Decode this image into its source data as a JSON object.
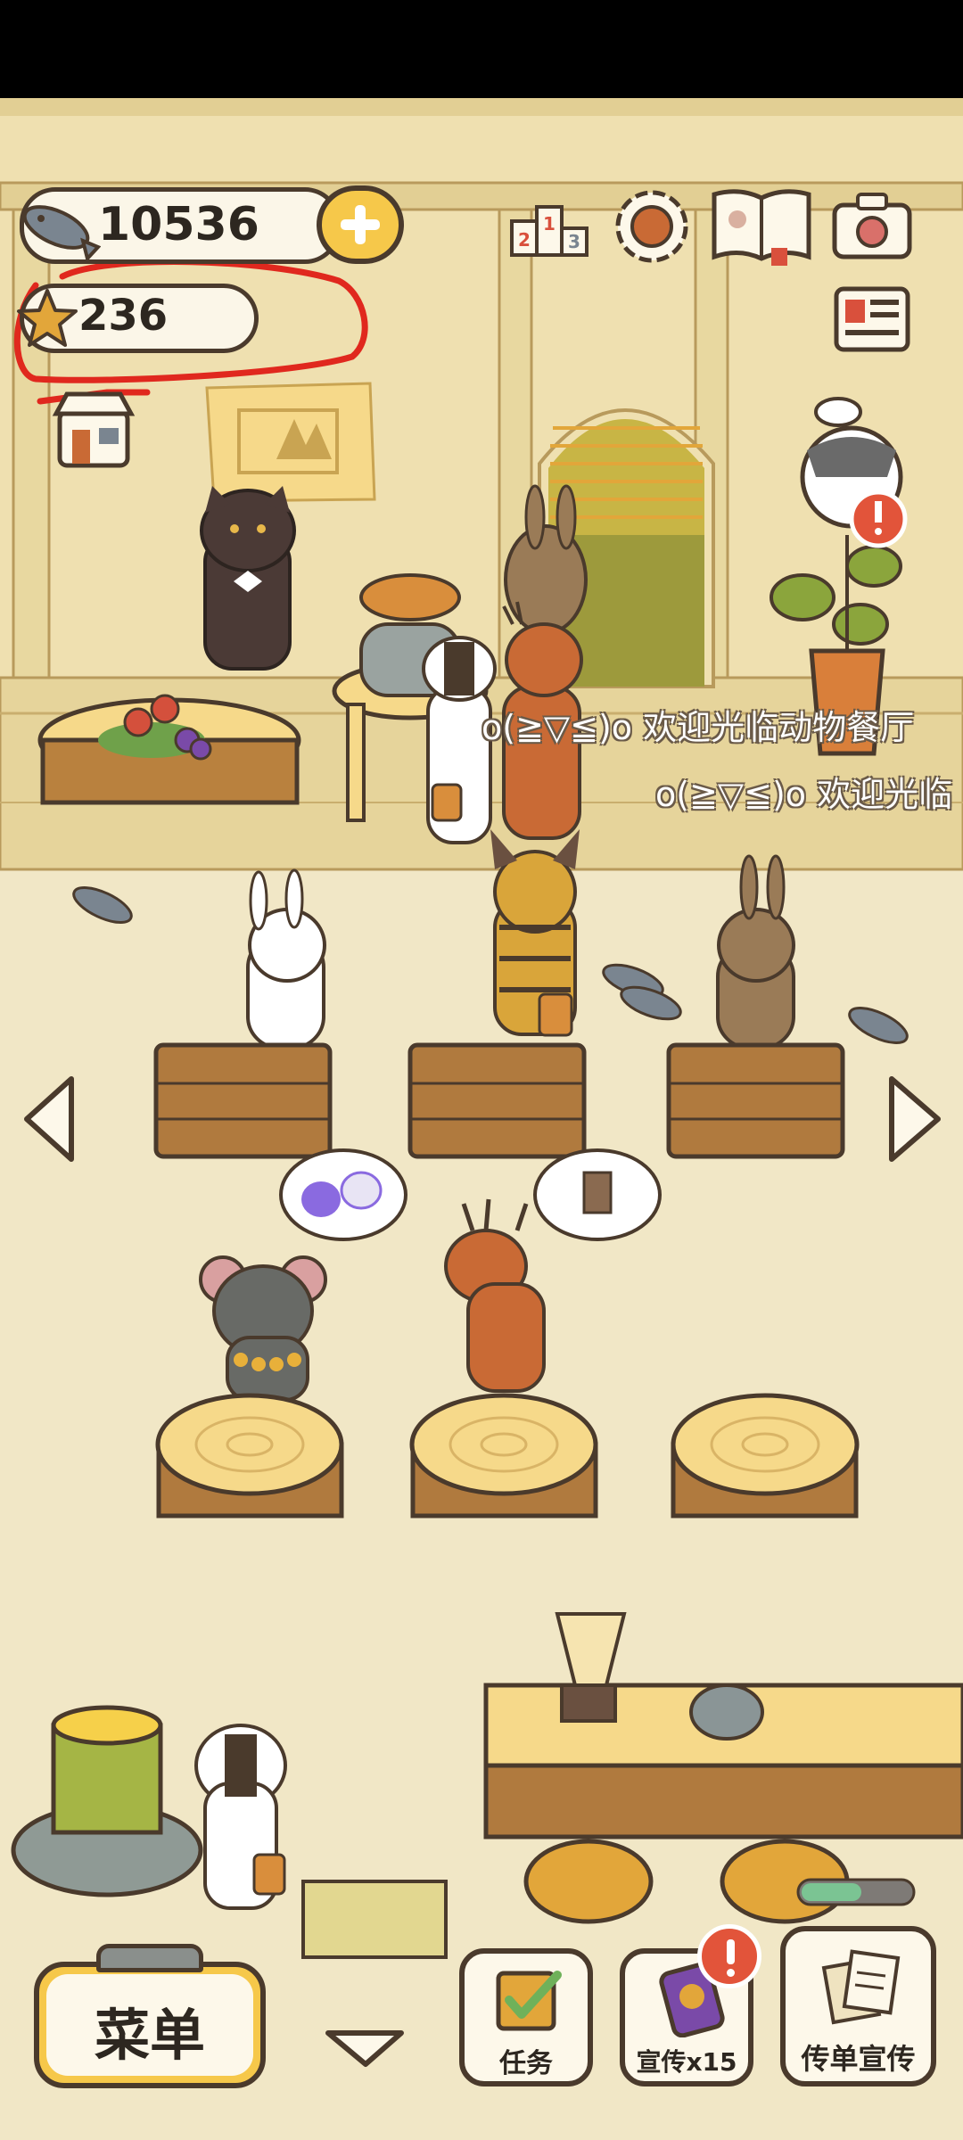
{
  "hud": {
    "fish_count": "10536",
    "star_count": "236"
  },
  "banners": {
    "line1": "o(≧▽≦)o 欢迎光临动物餐厅",
    "line2": "o(≧▽≦)o 欢迎光临"
  },
  "bottom": {
    "menu_label": "菜单",
    "task_label": "任务",
    "promo_label": "宣传x15",
    "flyer_label": "传单宣传"
  },
  "colors": {
    "annotation": "#e0281e",
    "wall": "#efe0b0",
    "floor": "#f1e7c6",
    "wood": "#9a6a3a",
    "accent_yellow": "#f6c84a",
    "progress": "#7bc493"
  },
  "progress": {
    "fill_fraction": 0.55
  },
  "icons": [
    "fish-icon",
    "star-icon",
    "plus-icon",
    "ranking-icon",
    "settings-gear-icon",
    "album-book-icon",
    "camera-icon",
    "newspaper-icon",
    "shop-icon",
    "alert-icon",
    "checklist-icon",
    "phone-promo-icon",
    "flyer-icon",
    "arrow-left-icon",
    "arrow-right-icon",
    "arrow-down-icon"
  ]
}
